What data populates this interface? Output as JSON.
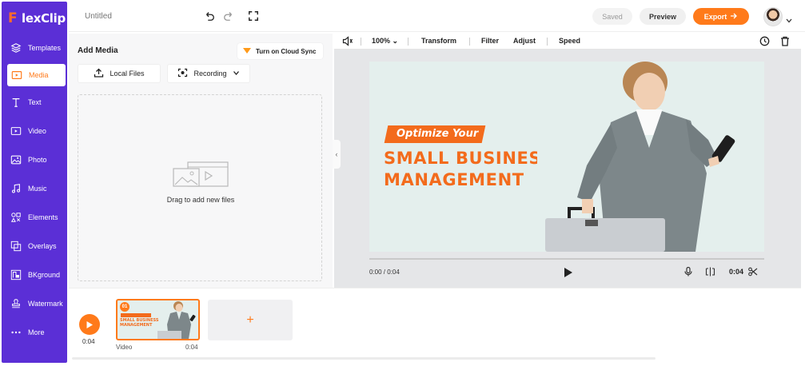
{
  "app": {
    "name": "FlexClip",
    "logo_f": "F",
    "logo_rest": "lexClip"
  },
  "colors": {
    "sidebar": "#5b2fd6",
    "accent": "#ff7a1a",
    "headline": "#f36b1c"
  },
  "sidebar": {
    "items": [
      {
        "label": "Templates",
        "icon": "layers-icon"
      },
      {
        "label": "Media",
        "icon": "media-folder-icon",
        "active": true
      },
      {
        "label": "Text",
        "icon": "text-icon"
      },
      {
        "label": "Video",
        "icon": "video-icon"
      },
      {
        "label": "Photo",
        "icon": "photo-icon"
      },
      {
        "label": "Music",
        "icon": "music-icon"
      },
      {
        "label": "Elements",
        "icon": "elements-icon"
      },
      {
        "label": "Overlays",
        "icon": "overlays-icon"
      },
      {
        "label": "BKground",
        "icon": "background-icon"
      },
      {
        "label": "Watermark",
        "icon": "watermark-icon"
      },
      {
        "label": "More",
        "icon": "more-icon"
      }
    ]
  },
  "topbar": {
    "title_placeholder": "Untitled",
    "saved": "Saved",
    "preview": "Preview",
    "export": "Export"
  },
  "media": {
    "title": "Add Media",
    "cloud_sync": "Turn on Cloud Sync",
    "local_files": "Local Files",
    "recording": "Recording",
    "drop_text": "Drag to add new files"
  },
  "preview_toolbar": {
    "zoom": "100%",
    "transform": "Transform",
    "filter": "Filter",
    "adjust": "Adjust",
    "speed": "Speed"
  },
  "canvas": {
    "tag": "Optimize Your",
    "headline_1": "SMALL BUSINESS",
    "headline_2": "MANAGEMENT"
  },
  "player": {
    "current_time": "0:00 / 0:04",
    "duration": "0:04",
    "progress": 0
  },
  "timeline": {
    "time": "0:04",
    "clip": {
      "number": "01",
      "label": "Video",
      "duration": "0:04",
      "mini_1": "SMALL BUSINESS",
      "mini_2": "MANAGEMENT"
    },
    "add_label": "+"
  }
}
